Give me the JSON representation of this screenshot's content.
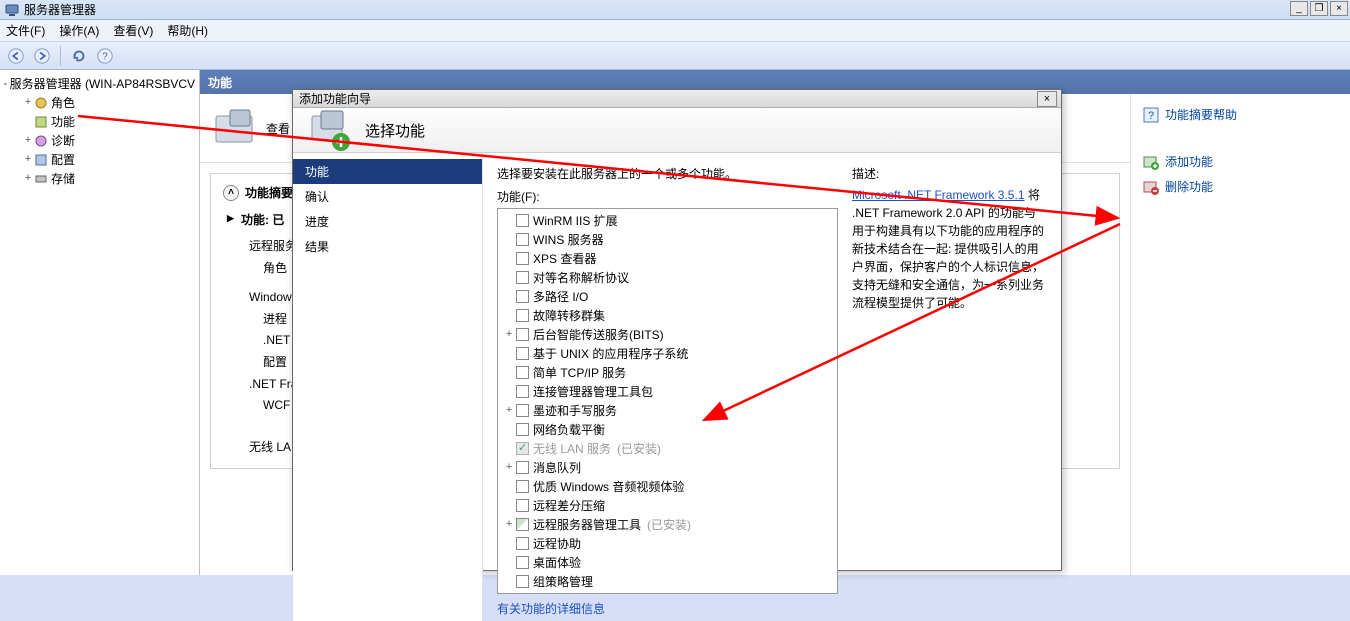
{
  "main_window": {
    "title": "服务器管理器",
    "wincontrols": {
      "min": "_",
      "restore": "❐",
      "close": "×"
    }
  },
  "menubar": {
    "file": "文件(F)",
    "action": "操作(A)",
    "view": "查看(V)",
    "help": "帮助(H)"
  },
  "tree": {
    "root": "服务器管理器 (WIN-AP84RSBVCV",
    "roles": "角色",
    "features": "功能",
    "diagnostics": "诊断",
    "config": "配置",
    "storage": "存储"
  },
  "center": {
    "header": "功能",
    "search_hint": "查看",
    "summary_header": "功能摘要",
    "features_installed_label": "功能: 已",
    "remote_services_role": "远程服务",
    "role_label": "角色",
    "windows_label": "Windows",
    "process_label": "进程",
    "dotnet_label": ".NET",
    "config_label": "配置",
    "dotnet_fra_label": ".NET Fra",
    "wcf_label": "WCF",
    "wireless_label": "无线 LAN"
  },
  "right_actions": {
    "help": "功能摘要帮助",
    "add": "添加功能",
    "remove": "删除功能"
  },
  "wizard": {
    "title": "添加功能向导",
    "header": "选择功能",
    "nav": {
      "features": "功能",
      "confirm": "确认",
      "progress": "进度",
      "results": "结果"
    },
    "instruction": "选择要安装在此服务器上的一个或多个功能。",
    "features_label": "功能(F):",
    "desc_label": "描述:",
    "desc_link": "Microsoft .NET Framework 3.5.1",
    "desc_body": "将 .NET Framework 2.0 API 的功能与用于构建具有以下功能的应用程序的新技术结合在一起: 提供吸引人的用户界面，保护客户的个人标识信息，支持无缝和安全通信，为一系列业务流程模型提供了可能。",
    "more_link": "有关功能的详细信息",
    "items": [
      {
        "exp": "",
        "label": "WinRM IIS 扩展",
        "checked": false
      },
      {
        "exp": "",
        "label": "WINS 服务器",
        "checked": false
      },
      {
        "exp": "",
        "label": "XPS 查看器",
        "checked": false
      },
      {
        "exp": "",
        "label": "对等名称解析协议",
        "checked": false
      },
      {
        "exp": "",
        "label": "多路径 I/O",
        "checked": false
      },
      {
        "exp": "",
        "label": "故障转移群集",
        "checked": false
      },
      {
        "exp": "+",
        "label": "后台智能传送服务(BITS)",
        "checked": false
      },
      {
        "exp": "",
        "label": "基于 UNIX 的应用程序子系统",
        "checked": false
      },
      {
        "exp": "",
        "label": "简单 TCP/IP 服务",
        "checked": false
      },
      {
        "exp": "",
        "label": "连接管理器管理工具包",
        "checked": false
      },
      {
        "exp": "+",
        "label": "墨迹和手写服务",
        "checked": false
      },
      {
        "exp": "",
        "label": "网络负载平衡",
        "checked": false
      },
      {
        "exp": "",
        "label": "无线 LAN 服务",
        "checked": true,
        "disabled": true,
        "installed": "(已安装)"
      },
      {
        "exp": "+",
        "label": "消息队列",
        "checked": false
      },
      {
        "exp": "",
        "label": "优质 Windows 音频视频体验",
        "checked": false
      },
      {
        "exp": "",
        "label": "远程差分压缩",
        "checked": false
      },
      {
        "exp": "+",
        "label": "远程服务器管理工具",
        "checked": false,
        "mixed": true,
        "installed": "(已安装)"
      },
      {
        "exp": "",
        "label": "远程协助",
        "checked": false
      },
      {
        "exp": "",
        "label": "桌面体验",
        "checked": false
      },
      {
        "exp": "",
        "label": "组策略管理",
        "checked": false
      }
    ]
  }
}
